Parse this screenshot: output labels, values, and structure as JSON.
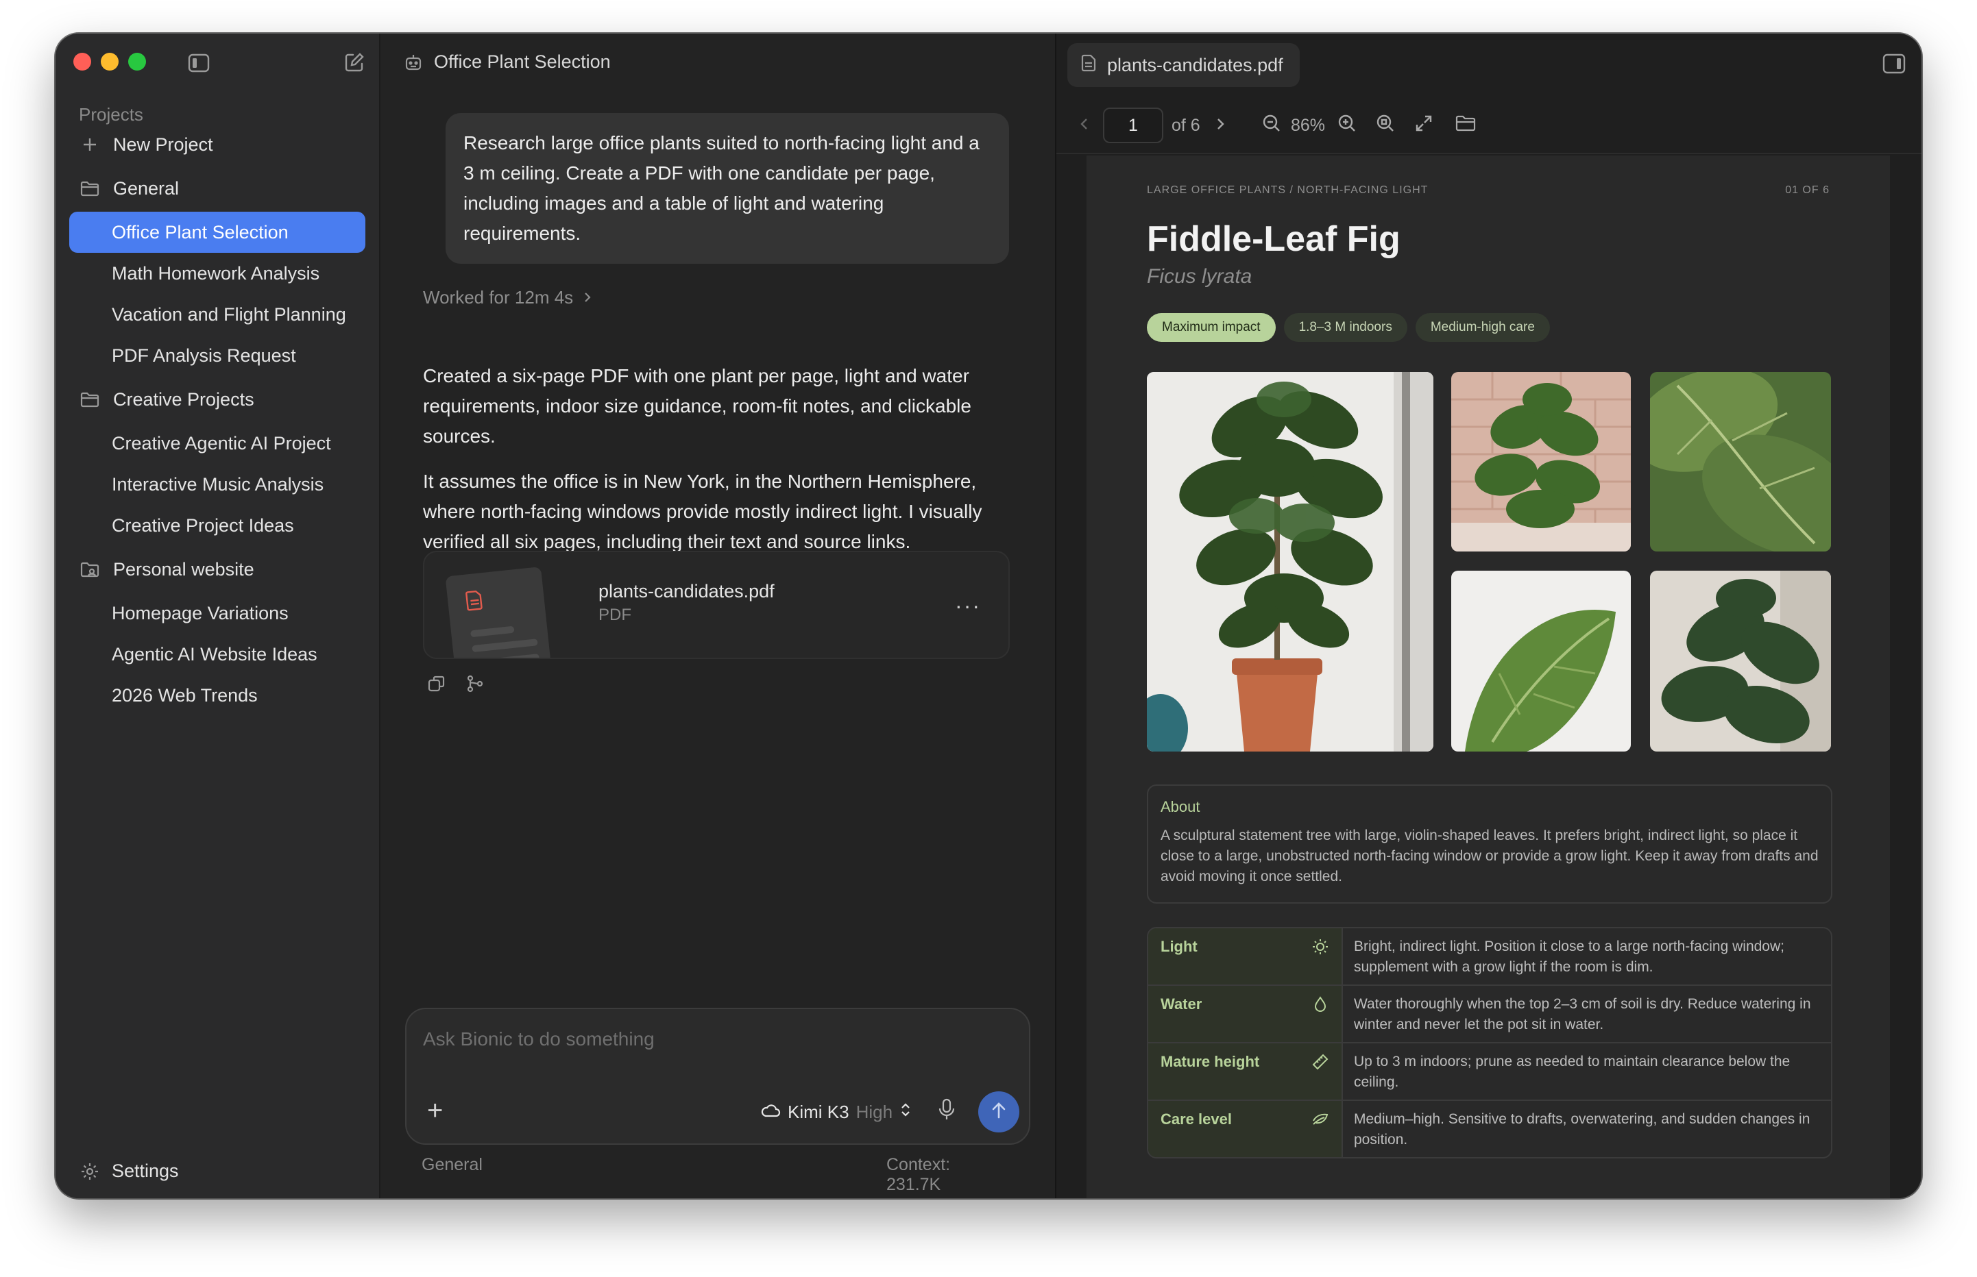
{
  "sidebar": {
    "section_label": "Projects",
    "new_project": "New Project",
    "groups": [
      {
        "label": "General",
        "items": [
          "Office Plant Selection",
          "Math Homework Analysis",
          "Vacation and Flight Planning",
          "PDF Analysis Request"
        ]
      },
      {
        "label": "Creative Projects",
        "items": [
          "Creative Agentic AI Project",
          "Interactive Music Analysis",
          "Creative Project Ideas"
        ]
      },
      {
        "label": "Personal website",
        "items": [
          "Homepage Variations",
          "Agentic AI Website Ideas",
          "2026 Web Trends"
        ]
      }
    ],
    "active_item": "Office Plant Selection",
    "settings": "Settings"
  },
  "chat": {
    "title": "Office Plant Selection",
    "user_message": "Research large office plants suited to north-facing light and a 3 m ceiling. Create a PDF with one candidate per page, including images and a table of light and watering requirements.",
    "worked_for": "Worked for 12m 4s",
    "reply_paragraphs": [
      "Created a six-page PDF with one plant per page, light and water requirements, indoor size guidance, room-fit notes, and clickable sources.",
      "It assumes the office is in New York, in the Northern Hemisphere, where north-facing windows provide mostly indirect light. I visually verified all six pages, including their text and source links."
    ],
    "attachment": {
      "name": "plants-candidates.pdf",
      "type": "PDF",
      "more": "···"
    },
    "composer": {
      "placeholder": "Ask Bionic to do something",
      "model": "Kimi K3",
      "mode": "High"
    },
    "footer_left": "General",
    "footer_right": "Context: 231.7K"
  },
  "viewer": {
    "tab_title": "plants-candidates.pdf",
    "page_current": "1",
    "page_total": "of 6",
    "zoom": "86%",
    "page": {
      "kicker": "LARGE OFFICE PLANTS / NORTH-FACING LIGHT",
      "counter": "01 OF 6",
      "title": "Fiddle-Leaf Fig",
      "subtitle": "Ficus lyrata",
      "tags": [
        "Maximum impact",
        "1.8–3 M indoors",
        "Medium-high care"
      ],
      "about_heading": "About",
      "about_text": "A sculptural statement tree with large, violin-shaped leaves. It prefers bright, indirect light, so place it close to a large, unobstructed north-facing window or provide a grow light. Keep it away from drafts and avoid moving it once settled.",
      "care": [
        {
          "key": "Light",
          "icon": "sun-icon",
          "value": "Bright, indirect light. Position it close to a large north-facing window; supplement with a grow light if the room is dim."
        },
        {
          "key": "Water",
          "icon": "droplet-icon",
          "value": "Water thoroughly when the top 2–3 cm of soil is dry. Reduce watering in winter and never let the pot sit in water."
        },
        {
          "key": "Mature height",
          "icon": "ruler-icon",
          "value": "Up to 3 m indoors; prune as needed to maintain clearance below the ceiling."
        },
        {
          "key": "Care level",
          "icon": "leaf-icon",
          "value": "Medium–high. Sensitive to drafts, overwatering, and sudden changes in position."
        }
      ]
    }
  }
}
